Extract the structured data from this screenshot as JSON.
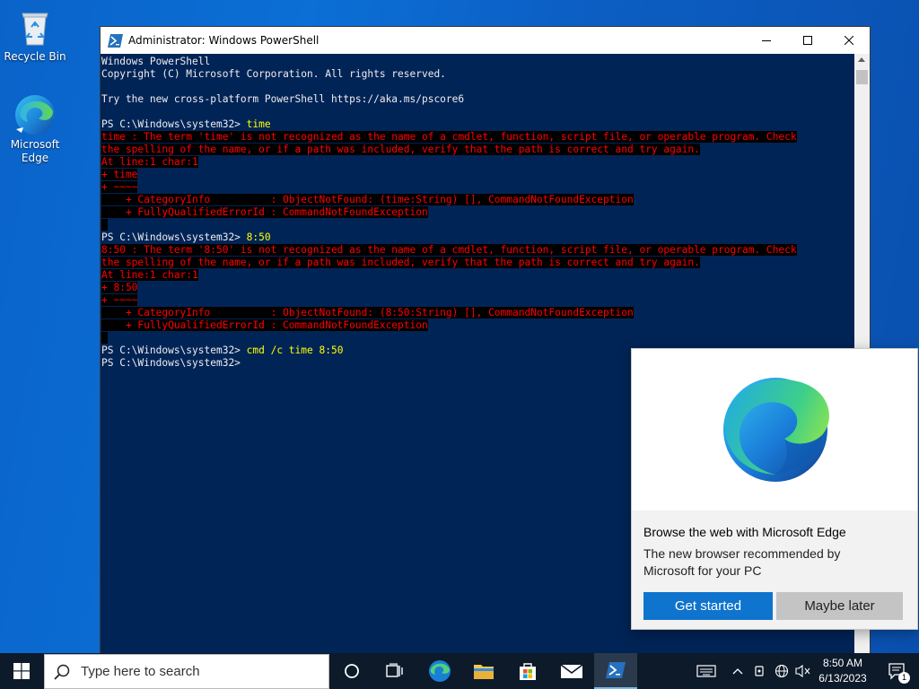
{
  "desktop": {
    "icons": [
      {
        "label": "Recycle Bin"
      },
      {
        "label": "Microsoft Edge"
      }
    ]
  },
  "powershell": {
    "title": "Administrator: Windows PowerShell",
    "lines": [
      {
        "type": "out",
        "text": "Windows PowerShell"
      },
      {
        "type": "out",
        "text": "Copyright (C) Microsoft Corporation. All rights reserved."
      },
      {
        "type": "out",
        "text": ""
      },
      {
        "type": "out",
        "text": "Try the new cross-platform PowerShell https://aka.ms/pscore6"
      },
      {
        "type": "out",
        "text": ""
      },
      {
        "type": "prompt",
        "prompt": "PS C:\\Windows\\system32> ",
        "cmd": "time"
      },
      {
        "type": "err",
        "text": "time : The term 'time' is not recognized as the name of a cmdlet, function, script file, or operable program. Check"
      },
      {
        "type": "err",
        "text": "the spelling of the name, or if a path was included, verify that the path is correct and try again."
      },
      {
        "type": "err",
        "text": "At line:1 char:1"
      },
      {
        "type": "err",
        "text": "+ time"
      },
      {
        "type": "err",
        "text": "+ ~~~~"
      },
      {
        "type": "err",
        "text": "    + CategoryInfo          : ObjectNotFound: (time:String) [], CommandNotFoundException"
      },
      {
        "type": "err",
        "text": "    + FullyQualifiedErrorId : CommandNotFoundException"
      },
      {
        "type": "blank-err",
        "text": " "
      },
      {
        "type": "prompt",
        "prompt": "PS C:\\Windows\\system32> ",
        "cmd": "8:50"
      },
      {
        "type": "err",
        "text": "8:50 : The term '8:50' is not recognized as the name of a cmdlet, function, script file, or operable program. Check"
      },
      {
        "type": "err",
        "text": "the spelling of the name, or if a path was included, verify that the path is correct and try again."
      },
      {
        "type": "err",
        "text": "At line:1 char:1"
      },
      {
        "type": "err",
        "text": "+ 8:50"
      },
      {
        "type": "err",
        "text": "+ ~~~~"
      },
      {
        "type": "err",
        "text": "    + CategoryInfo          : ObjectNotFound: (8:50:String) [], CommandNotFoundException"
      },
      {
        "type": "err",
        "text": "    + FullyQualifiedErrorId : CommandNotFoundException"
      },
      {
        "type": "blank-err",
        "text": " "
      },
      {
        "type": "prompt",
        "prompt": "PS C:\\Windows\\system32> ",
        "cmd": "cmd /c time 8:50"
      },
      {
        "type": "prompt",
        "prompt": "PS C:\\Windows\\system32> ",
        "cmd": ""
      }
    ]
  },
  "edge_popup": {
    "heading": "Browse the web with Microsoft Edge",
    "body": "The new browser recommended by Microsoft for your PC",
    "primary_button": "Get started",
    "secondary_button": "Maybe later"
  },
  "taskbar": {
    "search_placeholder": "Type here to search",
    "apps": [
      "cortana-icon",
      "task-view-icon",
      "edge-icon",
      "file-explorer-icon",
      "store-icon",
      "mail-icon",
      "powershell-icon"
    ],
    "clock_time": "8:50 AM",
    "clock_date": "6/13/2023",
    "notification_count": "1"
  },
  "colors": {
    "console_bg": "#012456",
    "console_fg": "#eeedf0",
    "error_fg": "#ff0000",
    "command_fg": "#ffff00",
    "accent": "#0f74cd",
    "taskbar_bg": "#0c1a2a"
  }
}
